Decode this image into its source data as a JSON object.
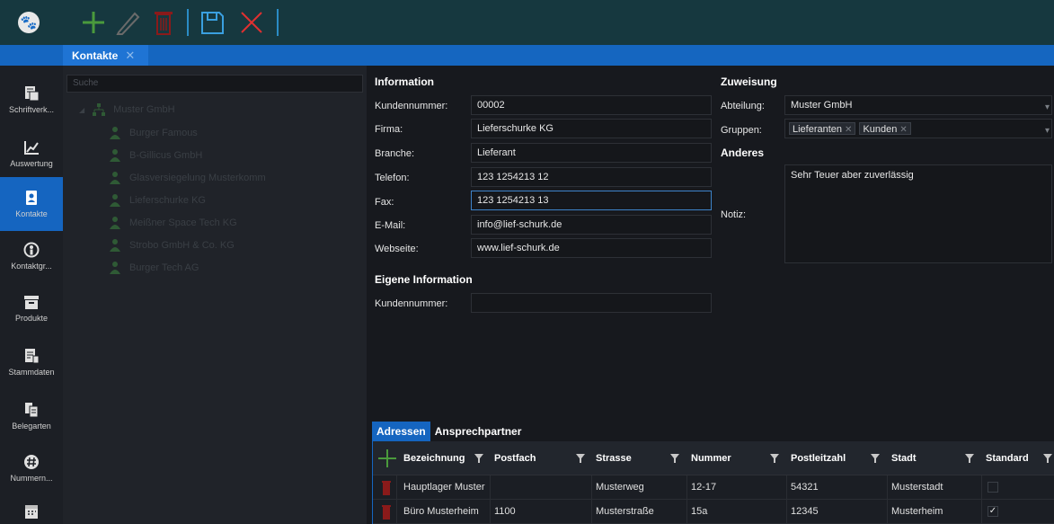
{
  "toolbar": {
    "logo": "paw-icon",
    "buttons": [
      {
        "name": "add-icon",
        "color": "#4a9a3c"
      },
      {
        "name": "edit-icon",
        "color": "#6a6a6a"
      },
      {
        "name": "delete-icon",
        "color": "#8a1a1a"
      },
      {
        "name": "save-icon",
        "color": "#3aa0e0"
      },
      {
        "name": "cancel-icon",
        "color": "#e03030"
      }
    ]
  },
  "tabs": [
    {
      "label": "Kontakte",
      "close": "✕"
    }
  ],
  "nav": [
    {
      "label": "Schriftverk...",
      "icon": "document-icon"
    },
    {
      "label": "Auswertung",
      "icon": "chart-icon"
    },
    {
      "label": "Kontakte",
      "icon": "contacts-icon",
      "active": true
    },
    {
      "label": "Kontaktgr...",
      "icon": "contact-group-icon"
    },
    {
      "label": "Produkte",
      "icon": "box-icon"
    },
    {
      "label": "Stammdaten",
      "icon": "master-data-icon"
    },
    {
      "label": "Belegarten",
      "icon": "documents-icon"
    },
    {
      "label": "Nummern...",
      "icon": "number-icon"
    },
    {
      "label": "",
      "icon": "calendar-icon"
    }
  ],
  "tree": {
    "search_placeholder": "Suche",
    "root": "Muster GmbH",
    "children": [
      "Burger Famous",
      "B-Gillicus GmbH",
      "Glasversiegelung Musterkomm",
      "Lieferschurke KG",
      "Meißner Space Tech KG",
      "Strobo GmbH & Co. KG",
      "Burger Tech AG"
    ]
  },
  "info": {
    "title": "Information",
    "fields": [
      {
        "label": "Kundennummer:",
        "value": "00002"
      },
      {
        "label": "Firma:",
        "value": "Lieferschurke KG"
      },
      {
        "label": "Branche:",
        "value": "Lieferant"
      },
      {
        "label": "Telefon:",
        "value": "123 1254213 12"
      },
      {
        "label": "Fax:",
        "value": "123 1254213 13"
      },
      {
        "label": "E-Mail:",
        "value": "info@lief-schurk.de"
      },
      {
        "label": "Webseite:",
        "value": "www.lief-schurk.de"
      }
    ]
  },
  "own_info": {
    "title": "Eigene Information",
    "fields": [
      {
        "label": "Kundennummer:",
        "value": ""
      }
    ]
  },
  "assignment": {
    "title": "Zuweisung",
    "department_label": "Abteilung:",
    "department_value": "Muster GmbH",
    "groups_label": "Gruppen:",
    "groups": [
      "Lieferanten",
      "Kunden"
    ]
  },
  "other": {
    "title": "Anderes",
    "note_label": "Notiz:",
    "note_value": "Sehr Teuer aber zuverlässig"
  },
  "subtabs": [
    {
      "label": "Adressen",
      "active": true
    },
    {
      "label": "Ansprechpartner",
      "active": false
    }
  ],
  "grid": {
    "columns": [
      "Bezeichnung",
      "Postfach",
      "Strasse",
      "Nummer",
      "Postleitzahl",
      "Stadt",
      "Standard"
    ],
    "rows": [
      {
        "cells": [
          "Hauptlager Muster",
          "",
          "Musterweg",
          "12-17",
          "54321",
          "Musterstadt"
        ],
        "standard": false
      },
      {
        "cells": [
          "Büro Musterheim",
          "1100",
          "Musterstraße",
          "15a",
          "12345",
          "Musterheim"
        ],
        "standard": true
      }
    ]
  }
}
